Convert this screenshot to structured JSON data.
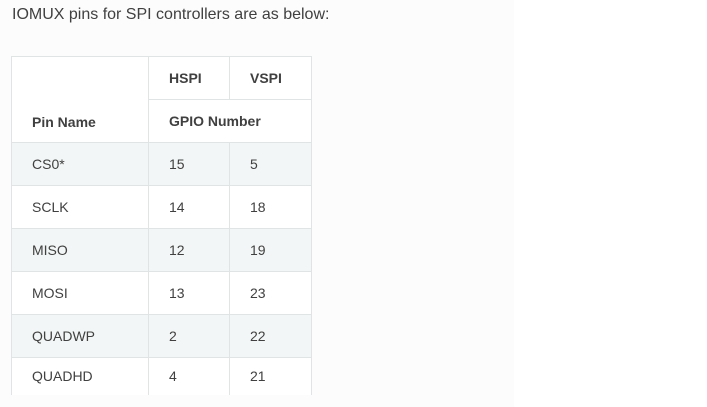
{
  "intro_text": "IOMUX pins for SPI controllers are as below:",
  "table": {
    "header": {
      "pin_name": "Pin Name",
      "hspi": "HSPI",
      "vspi": "VSPI",
      "gpio_number": "GPIO Number"
    },
    "rows": [
      {
        "pin": "CS0*",
        "hspi": "15",
        "vspi": "5"
      },
      {
        "pin": "SCLK",
        "hspi": "14",
        "vspi": "18"
      },
      {
        "pin": "MISO",
        "hspi": "12",
        "vspi": "19"
      },
      {
        "pin": "MOSI",
        "hspi": "13",
        "vspi": "23"
      },
      {
        "pin": "QUADWP",
        "hspi": "2",
        "vspi": "22"
      },
      {
        "pin": "QUADHD",
        "hspi": "4",
        "vspi": "21"
      }
    ]
  }
}
